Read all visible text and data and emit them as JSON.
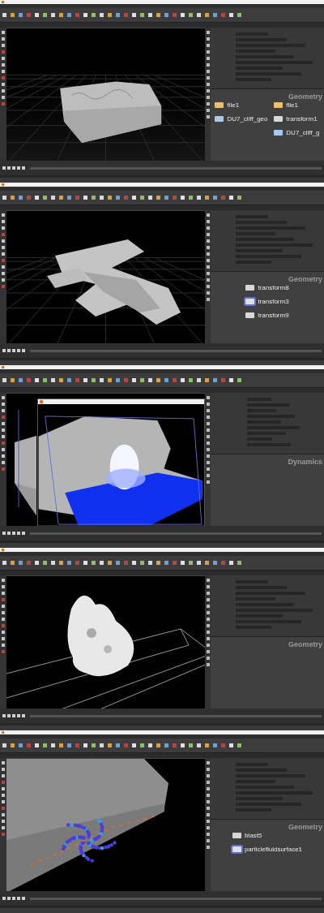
{
  "panels": [
    {
      "kind": "cliff",
      "network_label": "Geometry",
      "columns": [
        [
          {
            "label": "file1",
            "kind": "file"
          },
          {
            "label": "DU7_cliff_geo",
            "kind": "null"
          }
        ],
        [
          {
            "label": "file1",
            "kind": "file"
          },
          {
            "label": "transform1",
            "kind": "transform"
          },
          {
            "label": "DU7_cliff_g",
            "kind": "null"
          }
        ]
      ]
    },
    {
      "kind": "spaceship",
      "network_label": "Geometry",
      "columns": [
        [
          {
            "label": "transform8",
            "kind": "transform"
          },
          {
            "label": "transform3",
            "kind": "selected"
          },
          {
            "label": "transform9",
            "kind": "transform"
          }
        ]
      ]
    },
    {
      "kind": "mplay",
      "network_label": "Dynamics"
    },
    {
      "kind": "splash",
      "network_label": "Geometry"
    },
    {
      "kind": "particles",
      "network_label": "Geometry",
      "columns": [
        [
          {
            "label": "blast5",
            "kind": "transform"
          },
          {
            "label": "particlefluidsurface1",
            "kind": "selected"
          }
        ]
      ]
    }
  ]
}
